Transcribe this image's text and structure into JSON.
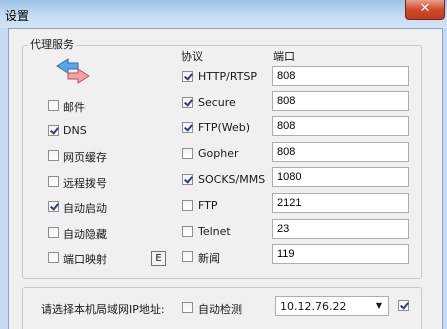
{
  "window": {
    "title": "设置",
    "close_glyph": "✕"
  },
  "proxy_group": {
    "title": "代理服务",
    "icon": "network-arrows-icon",
    "protocol_header": "协议",
    "port_header": "端口",
    "options": [
      {
        "label": "邮件",
        "checked": false
      },
      {
        "label": "DNS",
        "checked": true
      },
      {
        "label": "网页缓存",
        "checked": false
      },
      {
        "label": "远程拨号",
        "checked": false
      },
      {
        "label": "自动启动",
        "checked": true
      },
      {
        "label": "自动隐藏",
        "checked": false
      },
      {
        "label": "端口映射",
        "checked": false
      }
    ],
    "port_mapping_button": "E",
    "protocols": [
      {
        "label": "HTTP/RTSP",
        "checked": true,
        "port": "808"
      },
      {
        "label": "Secure",
        "checked": true,
        "port": "808"
      },
      {
        "label": "FTP(Web)",
        "checked": true,
        "port": "808"
      },
      {
        "label": "Gopher",
        "checked": false,
        "port": "808"
      },
      {
        "label": "SOCKS/MMS",
        "checked": true,
        "port": "1080"
      },
      {
        "label": "FTP",
        "checked": false,
        "port": "2121"
      },
      {
        "label": "Telnet",
        "checked": false,
        "port": "23"
      },
      {
        "label": "新闻",
        "checked": false,
        "port": "119"
      }
    ]
  },
  "ip_group": {
    "label": "请选择本机局域网IP地址:",
    "auto_detect_label": "自动检测",
    "auto_detect_checked": false,
    "selected_ip": "10.12.76.22",
    "extra_checked": true
  }
}
